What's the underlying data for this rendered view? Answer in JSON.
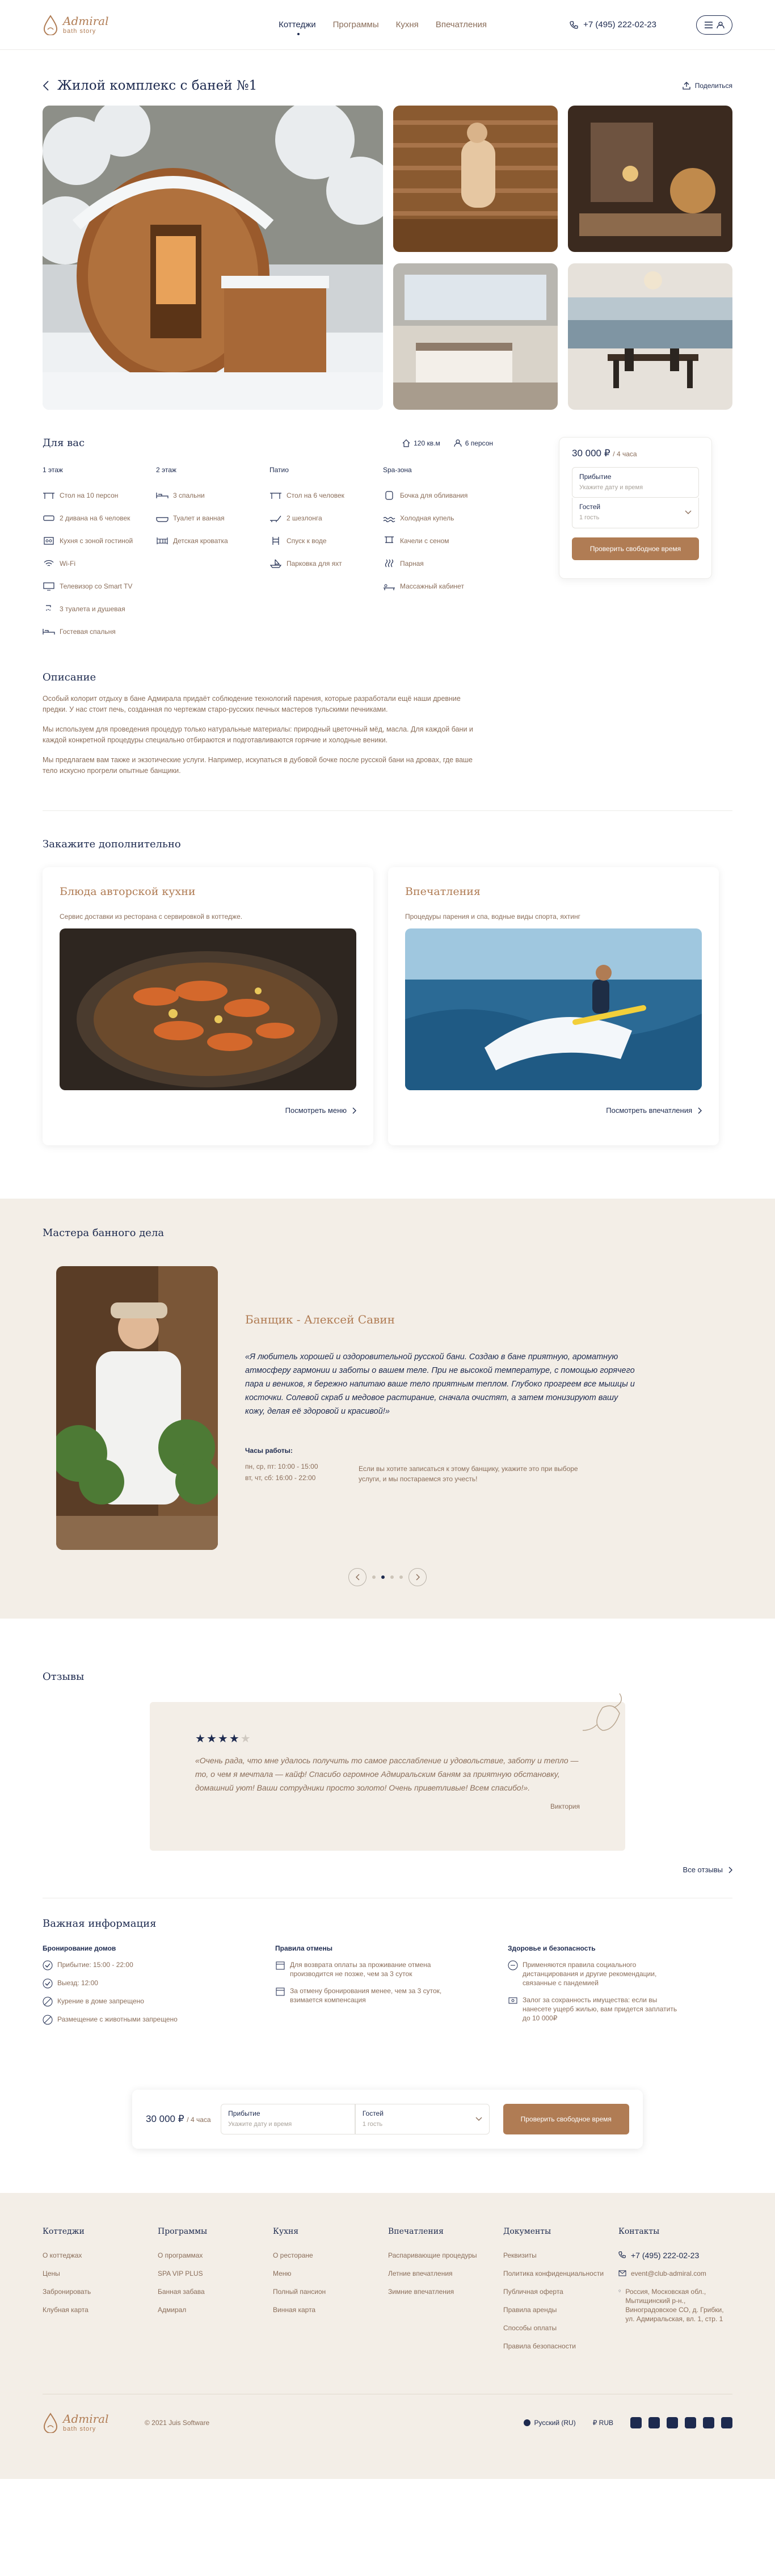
{
  "header": {
    "logo_title": "Admiral",
    "logo_sub": "bath story",
    "nav": [
      "Коттеджи",
      "Программы",
      "Кухня",
      "Впечатления"
    ],
    "phone": "+7 (495) 222-02-23"
  },
  "page": {
    "title": "Жилой комплекс с баней №1",
    "share": "Поделиться"
  },
  "foryou": {
    "title": "Для вас",
    "area": "120 кв.м",
    "persons": "6 персон",
    "columns": [
      {
        "head": "1 этаж",
        "items": [
          "Стол на 10 персон",
          "2 дивана на 6 человек",
          "Кухня с зоной гостиной",
          "Wi-Fi",
          "Телевизор со Smart TV",
          "3 туалета и душевая",
          "Гостевая спальня"
        ]
      },
      {
        "head": "2 этаж",
        "items": [
          "3 спальни",
          "Туалет и ванная",
          "Детская кроватка"
        ]
      },
      {
        "head": "Патио",
        "items": [
          "Стол на 6 человек",
          "2 шезлонга",
          "Спуск к воде",
          "Парковка для яхт"
        ]
      },
      {
        "head": "Spa-зона",
        "items": [
          "Бочка для обливания",
          "Холодная купель",
          "Качели с сеном",
          "Парная",
          "Массажный кабинет"
        ]
      }
    ]
  },
  "booking": {
    "price": "30 000 ₽",
    "per": "/ 4 часа",
    "arrive_label": "Прибытие",
    "arrive_placeholder": "Укажите дату и время",
    "guests_label": "Гостей",
    "guests_value": "1 гость",
    "check_button": "Проверить свободное время"
  },
  "description": {
    "title": "Описание",
    "p1": "Особый колорит отдыху в бане Адмирала придаёт соблюдение технологий парения, которые разработали ещё наши древние предки. У нас стоит печь, созданная по чертежам старо-русских печных мастеров тульскими печниками.",
    "p2": "Мы используем для проведения процедур только натуральные материалы: природный цветочный мёд, масла. Для каждой бани и каждой конкретной процедуры специально отбираются и подготавливаются горячие и холодные веники.",
    "p3": "Мы предлагаем вам также и экзотические услуги. Например, искупаться в дубовой бочке после русской бани на дровах, где ваше тело искусно прогрели опытные банщики."
  },
  "order": {
    "title": "Закажите дополнительно",
    "cards": [
      {
        "title": "Блюда авторской кухни",
        "sub": "Сервис доставки из ресторана с сервировкой в коттедже.",
        "link": "Посмотреть меню"
      },
      {
        "title": "Впечатления",
        "sub": "Процедуры парения и спа, водные виды спорта, яхтинг",
        "link": "Посмотреть впечатления"
      }
    ]
  },
  "masters": {
    "title": "Мастера банного дела",
    "name": "Банщик - Алексей Савин",
    "quote": "«Я любитель хорошей и оздоровительной русской бани. Создаю в бане приятную, ароматную атмосферу гармонии и заботы о вашем теле. При не высокой температуре, с помощью горячего пара и веников, я бережно напитаю ваше тело приятным теплом. Глубоко прогреем все мышцы и косточки. Солевой скраб и медовое растирание, сначала очистят, а затем тонизируют вашу кожу, делая её здоровой и красивой!»",
    "hours_label": "Часы работы:",
    "hours_1": "пн, ср, пт: 10:00 - 15:00",
    "hours_2": "вт, чт, сб: 16:00 - 22:00",
    "note": "Если вы хотите записаться к этому банщику, укажите это при выборе услуги, и мы постараемся это учесть!"
  },
  "reviews": {
    "title": "Отзывы",
    "rating": 4,
    "text": "«Очень рада, что мне удалось получить то самое расслабление и удовольствие, заботу и тепло — то, о чем я мечтала — кайф! Спасибо огромное Адмиральским баням за приятную обстановку, домашний уют! Ваши сотрудники просто золото! Очень приветливые! Всем спасибо!».",
    "author": "Виктория",
    "all": "Все отзывы"
  },
  "important": {
    "title": "Важная информация",
    "columns": [
      {
        "head": "Бронирование домов",
        "items": [
          "Прибытие: 15:00 - 22:00",
          "Выезд: 12:00",
          "Курение в доме запрещено",
          "Размещение с животными запрещено"
        ]
      },
      {
        "head": "Правила отмены",
        "items": [
          "Для возврата оплаты за проживание отмена производится не позже, чем за 3 суток",
          "За отмену бронирования менее, чем за 3 суток, взимается компенсация"
        ]
      },
      {
        "head": "Здоровье и безопасность",
        "items": [
          "Применяются правила социального дистанцирования и другие рекомендации, связанные с пандемией",
          "Залог за сохранность имущества: если вы нанесете ущерб жилью, вам придется заплатить до 10 000₽"
        ]
      }
    ]
  },
  "footer": {
    "columns": [
      {
        "head": "Коттеджи",
        "items": [
          "О коттеджах",
          "Цены",
          "Забронировать",
          "Клубная карта"
        ]
      },
      {
        "head": "Программы",
        "items": [
          "О программах",
          "SPA VIP PLUS",
          "Банная забава",
          "Адмирал"
        ]
      },
      {
        "head": "Кухня",
        "items": [
          "О ресторане",
          "Меню",
          "Полный пансион",
          "Винная карта"
        ]
      },
      {
        "head": "Впечатления",
        "items": [
          "Распаривающие процедуры",
          "Летние впечатления",
          "Зимние впечатления"
        ]
      },
      {
        "head": "Документы",
        "items": [
          "Реквизиты",
          "Политика конфиденциальности",
          "Публичная оферта",
          "Правила аренды",
          "Способы оплаты",
          "Правила безопасности"
        ]
      },
      {
        "head": "Контакты",
        "items": [
          "+7 (495) 222-02-23",
          "event@club-admiral.com",
          "Россия, Московская обл., Мытищинский р-н., Виноградовское СО, д. Грибки, ул. Адмиральская, вл. 1, стр. 1"
        ]
      }
    ],
    "copyright": "© 2021 Juis Software",
    "lang": "Русский (RU)",
    "currency": "₽  RUB"
  }
}
